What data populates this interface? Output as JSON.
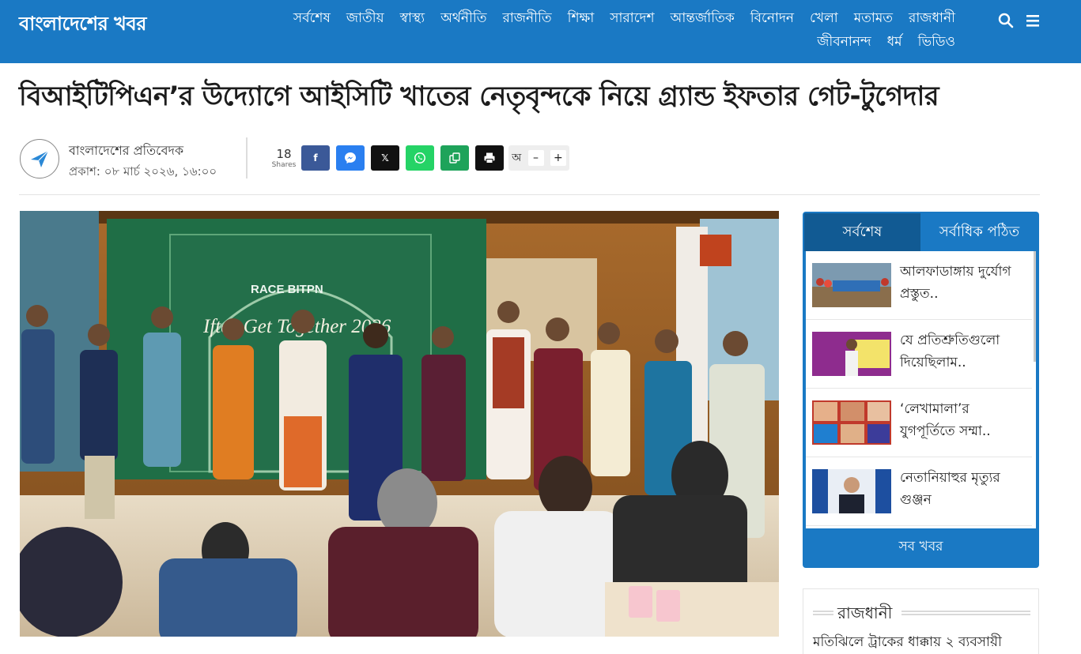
{
  "header": {
    "logo_text": "বাংলাদেশের খবর",
    "nav": [
      "সর্বশেষ",
      "জাতীয়",
      "স্বাস্থ্য",
      "অর্থনীতি",
      "রাজনীতি",
      "শিক্ষা",
      "সারাদেশ",
      "আন্তর্জাতিক",
      "বিনোদন",
      "খেলা",
      "মতামত",
      "রাজধানী",
      "জীবনানন্দ",
      "ধর্ম",
      "ভিডিও"
    ],
    "icons": [
      "search-icon",
      "menu-icon"
    ]
  },
  "article": {
    "headline": "বিআইটিপিএন’র উদ্যোগে আইসিটি খাতের নেতৃবৃন্দকে নিয়ে গ্র্যান্ড ইফতার গেট-টুগেদার",
    "author": "বাংলাদেশের প্রতিবেদক",
    "published": "প্রকাশ: ০৮ মার্চ ২০২৬, ১৬:০০",
    "shares_count": "18",
    "shares_label": "Shares",
    "font_size_label": "অ",
    "font_decrease": "–",
    "font_increase": "+"
  },
  "share_buttons": {
    "facebook": "f",
    "messenger": "messenger-icon",
    "x": "𝕏",
    "whatsapp": "whatsapp-icon",
    "copy": "copy-icon",
    "print": "print-icon"
  },
  "photo": {
    "banner_brands": "RACE  BITPN",
    "banner_title": "Iftar Get Together 2026"
  },
  "sidebar": {
    "tabs": [
      "সর্বশেষ",
      "সর্বাধিক পঠিত"
    ],
    "items": [
      {
        "title": "আলফাডাঙ্গায় দুর্যোগ প্রস্তুত.."
      },
      {
        "title": "যে প্রতিশ্রুতিগুলো দিয়েছিলাম.."
      },
      {
        "title": "‘লেখামালা’র যুগপূর্তিতে সম্মা.."
      },
      {
        "title": "নেতানিয়াহুর মৃত্যুর গুঞ্জন"
      }
    ],
    "all_news": "সব খবর"
  },
  "section_box": {
    "title": "রাজধানী",
    "first_headline": "মতিঝিলে ট্রাকের ধাক্কায় ২ ব্যবসায়ী"
  },
  "colors": {
    "brand_blue": "#1a79c4",
    "tab_active": "#115a93",
    "facebook": "#3b5998",
    "messenger": "#2a7ff0",
    "whatsapp": "#25d366",
    "copy": "#1ea35a"
  }
}
